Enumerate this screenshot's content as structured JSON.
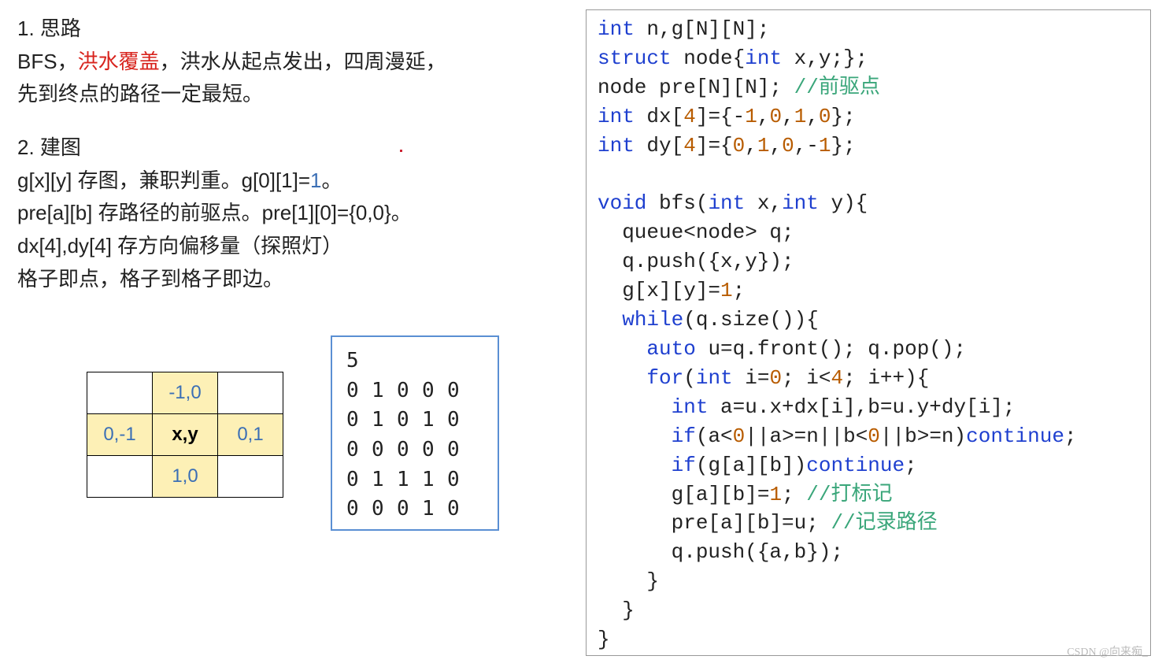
{
  "left": {
    "h1": "1. 思路",
    "p1a": "BFS，",
    "p1b_red": "洪水覆盖",
    "p1c": "，洪水从起点发出，四周漫延，",
    "p2": "先到终点的路径一定最短。",
    "h2": "2. 建图",
    "p3a": "g[x][y] 存图，兼职判重。g[0][1]=",
    "p3b_blue": "1",
    "p3c": "。",
    "p4": "pre[a][b] 存路径的前驱点。pre[1][0]={0,0}。",
    "p5": "dx[4],dy[4] 存方向偏移量（探照灯）",
    "p6": "格子即点，格子到格子即边。"
  },
  "dir": {
    "up": "-1,0",
    "left": "0,-1",
    "center": "x,y",
    "right": "0,1",
    "down": "1,0"
  },
  "sample": {
    "n": "5",
    "rows": [
      [
        "0",
        "1",
        "0",
        "0",
        "0"
      ],
      [
        "0",
        "1",
        "0",
        "1",
        "0"
      ],
      [
        "0",
        "0",
        "0",
        "0",
        "0"
      ],
      [
        "0",
        "1",
        "1",
        "1",
        "0"
      ],
      [
        "0",
        "0",
        "0",
        "1",
        "0"
      ]
    ]
  },
  "code": {
    "l01_a": "int",
    "l01_b": " n,g[N][N];",
    "l02_a": "struct",
    "l02_b": " node{",
    "l02_c": "int",
    "l02_d": " x,y;};",
    "l03_a": "node pre[N][N]; ",
    "l03_cm": "//前驱点",
    "l04_a": "int",
    "l04_b": " dx[",
    "l04_n1": "4",
    "l04_c": "]={-",
    "l04_n2": "1",
    "l04_d": ",",
    "l04_n3": "0",
    "l04_e": ",",
    "l04_n4": "1",
    "l04_f": ",",
    "l04_n5": "0",
    "l04_g": "};",
    "l05_a": "int",
    "l05_b": " dy[",
    "l05_n1": "4",
    "l05_c": "]={",
    "l05_n2": "0",
    "l05_d": ",",
    "l05_n3": "1",
    "l05_e": ",",
    "l05_n4": "0",
    "l05_f": ",-",
    "l05_n5": "1",
    "l05_g": "};",
    "l07_a": "void",
    "l07_b": " bfs(",
    "l07_c": "int",
    "l07_d": " x,",
    "l07_e": "int",
    "l07_f": " y){",
    "l08": "  queue<node> q;",
    "l09": "  q.push({x,y});",
    "l10_a": "  g[x][y]=",
    "l10_n": "1",
    "l10_b": ";",
    "l11_a": "  ",
    "l11_kw": "while",
    "l11_b": "(q.size()){",
    "l12_a": "    ",
    "l12_kw": "auto",
    "l12_b": " u=q.front(); q.pop();",
    "l13_a": "    ",
    "l13_kw": "for",
    "l13_b": "(",
    "l13_ty": "int",
    "l13_c": " i=",
    "l13_n1": "0",
    "l13_d": "; i<",
    "l13_n2": "4",
    "l13_e": "; i++){",
    "l14_a": "      ",
    "l14_ty": "int",
    "l14_b": " a=u.x+dx[i],b=u.y+dy[i];",
    "l15_a": "      ",
    "l15_kw": "if",
    "l15_b": "(a<",
    "l15_n1": "0",
    "l15_c": "||a>=n||b<",
    "l15_n2": "0",
    "l15_d": "||b>=n)",
    "l15_kw2": "continue",
    "l15_e": ";",
    "l16_a": "      ",
    "l16_kw": "if",
    "l16_b": "(g[a][b])",
    "l16_kw2": "continue",
    "l16_c": ";",
    "l17_a": "      g[a][b]=",
    "l17_n": "1",
    "l17_b": "; ",
    "l17_cm": "//打标记",
    "l18_a": "      pre[a][b]=u; ",
    "l18_cm": "//记录路径",
    "l19": "      q.push({a,b});",
    "l20": "    }",
    "l21": "  }",
    "l22": "}"
  },
  "watermark": "CSDN @向来痴_"
}
